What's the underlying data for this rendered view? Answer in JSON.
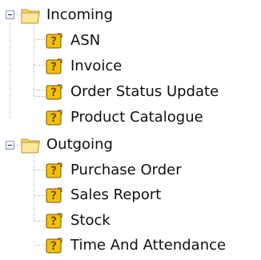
{
  "tree": {
    "nodes": [
      {
        "label": "Incoming",
        "icon": "folder-open-icon",
        "expanded": true,
        "children": [
          {
            "label": "ASN",
            "icon": "unknown-document-icon"
          },
          {
            "label": "Invoice",
            "icon": "unknown-document-icon"
          },
          {
            "label": "Order Status Update",
            "icon": "unknown-document-icon"
          },
          {
            "label": "Product Catalogue",
            "icon": "unknown-document-icon"
          }
        ]
      },
      {
        "label": "Outgoing",
        "icon": "folder-open-icon",
        "expanded": true,
        "children": [
          {
            "label": "Purchase Order",
            "icon": "unknown-document-icon"
          },
          {
            "label": "Sales Report",
            "icon": "unknown-document-icon"
          },
          {
            "label": "Stock",
            "icon": "unknown-document-icon"
          },
          {
            "label": "Time And Attendance",
            "icon": "unknown-document-icon"
          }
        ]
      }
    ],
    "colors": {
      "text": "#111111",
      "guide_line": "#a0a0a0",
      "folder": "#f7d774",
      "folder_edge": "#b8902a",
      "leaf_icon_yellow": "#f2c200",
      "leaf_icon_brown": "#7a4f12"
    }
  }
}
